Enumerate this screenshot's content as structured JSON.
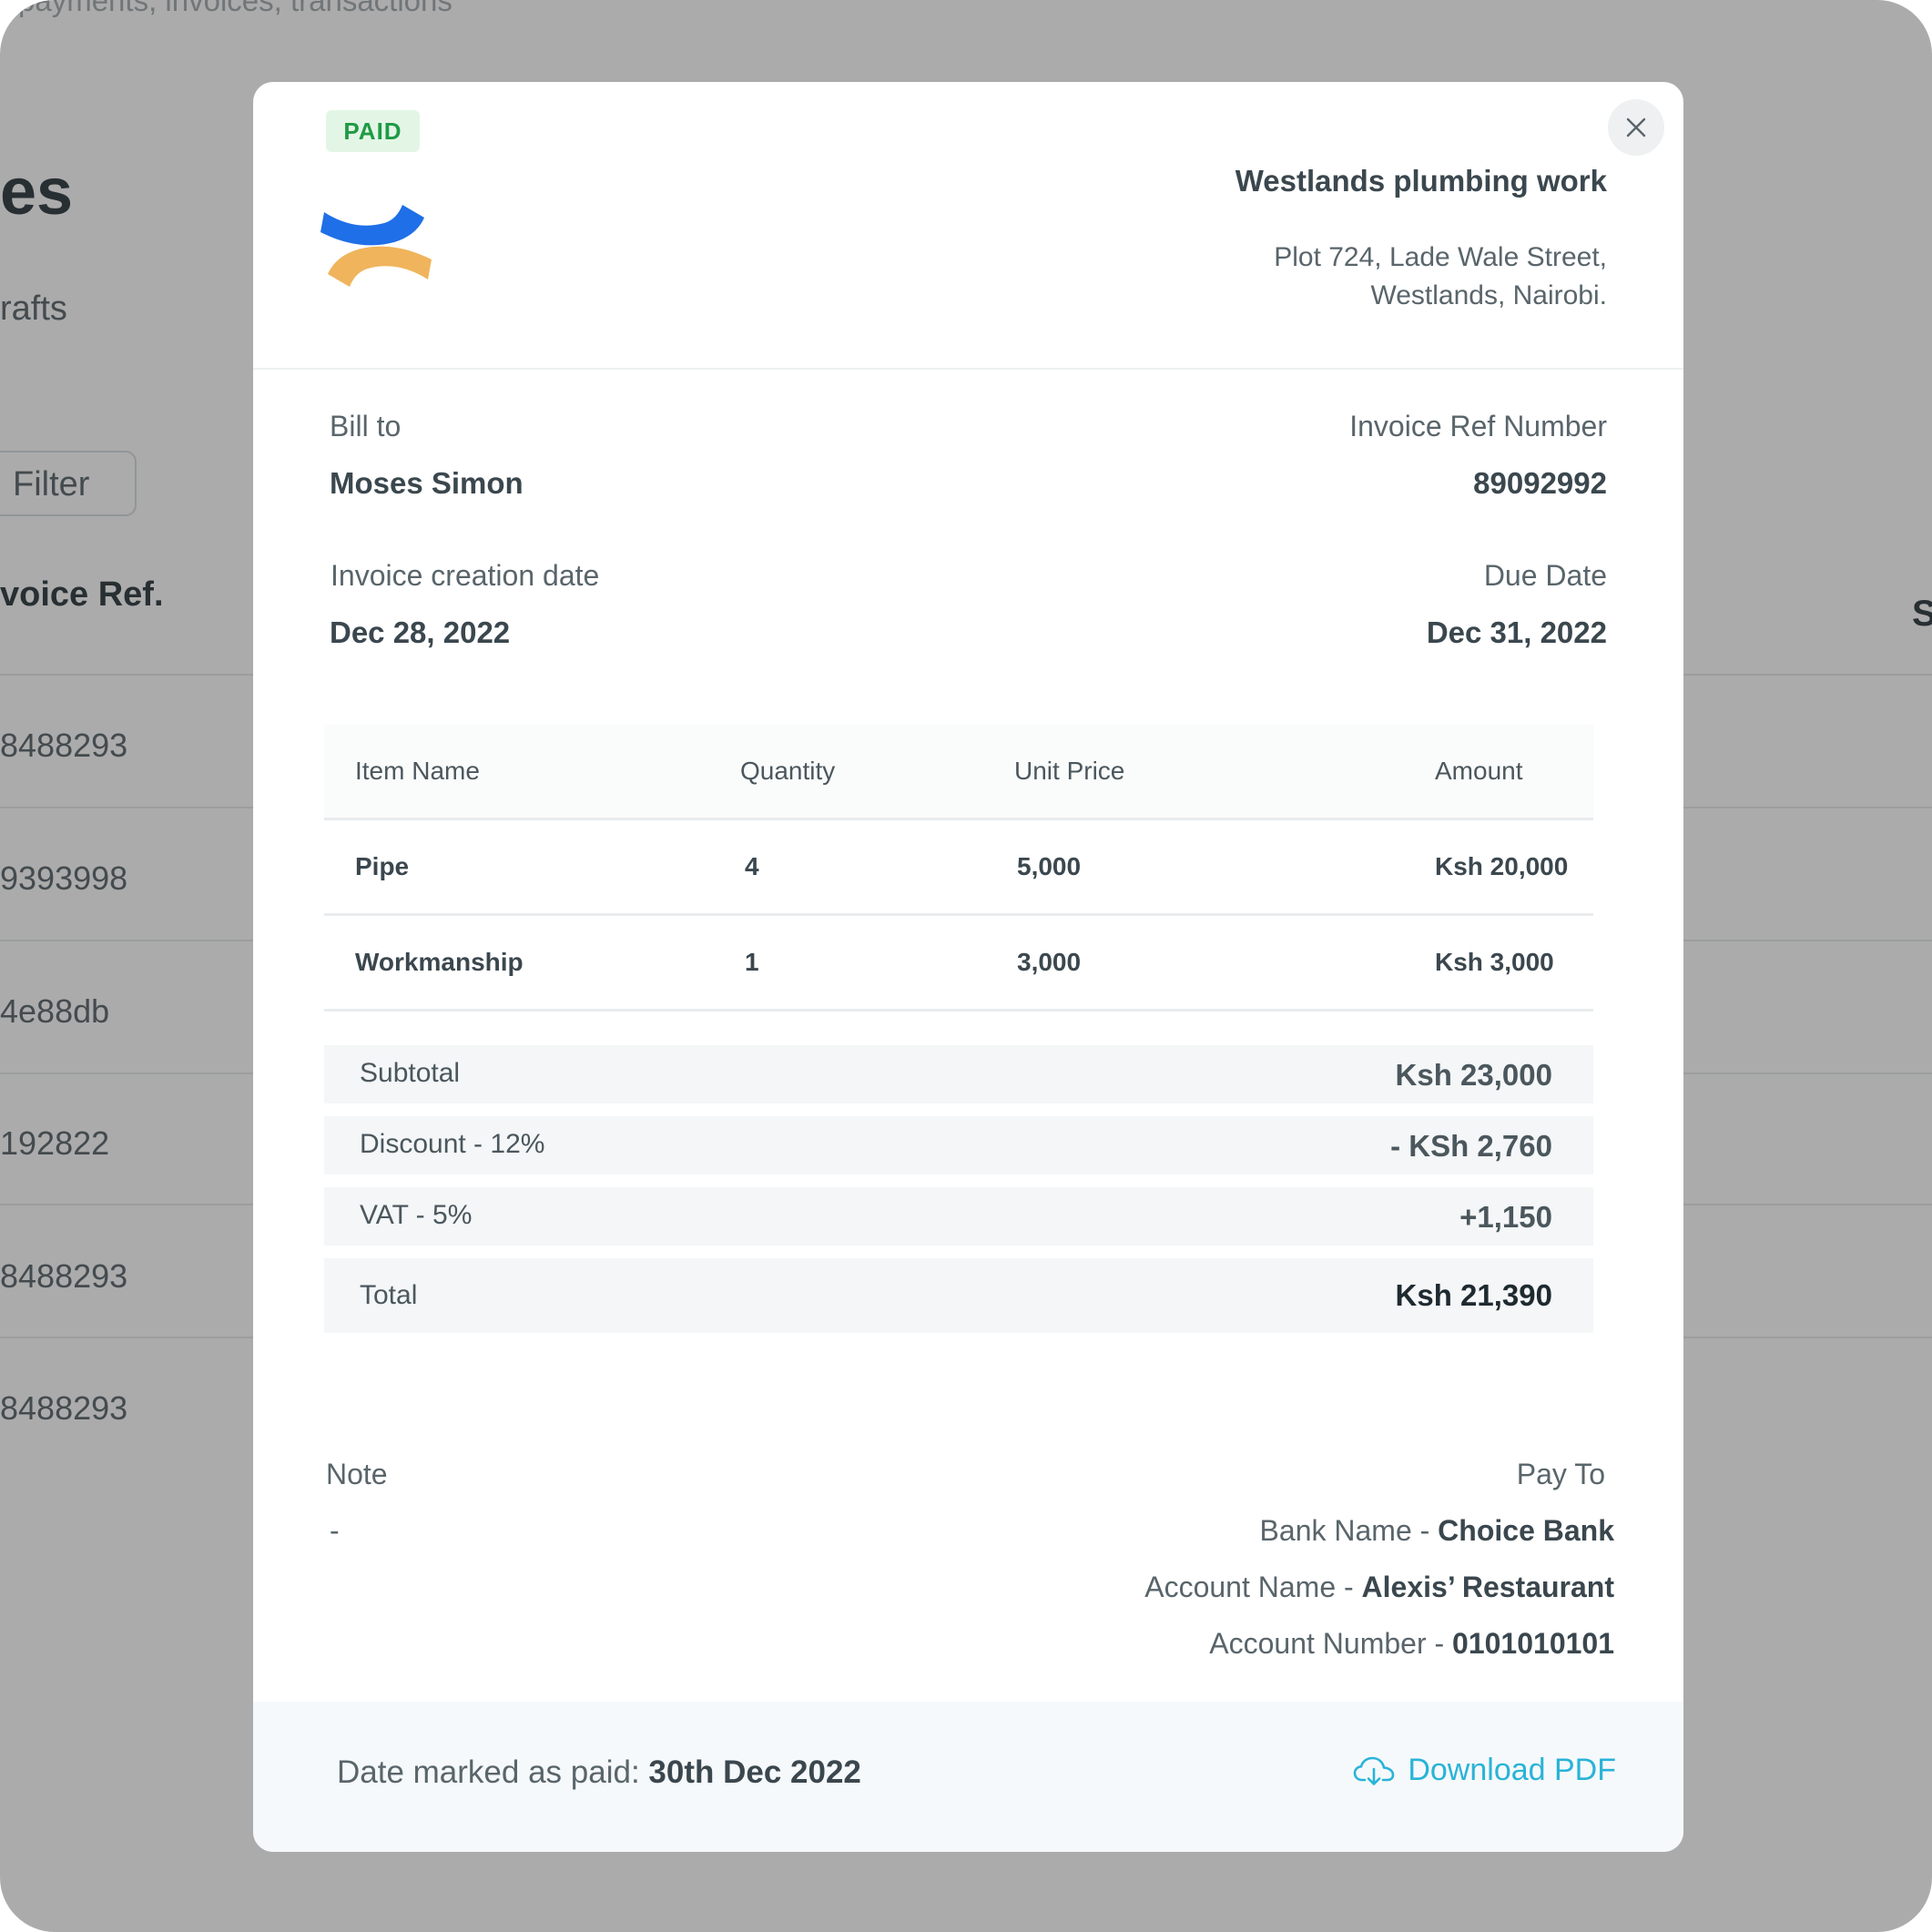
{
  "background": {
    "subtitle": "payments, invoices, transactions",
    "title_fragment": "es",
    "tab_fragment": "rafts",
    "filter_label": "Filter",
    "column_header_fragment": "voice Ref.",
    "column_header_right_fragment": "S",
    "rows": [
      "8488293",
      "9393998",
      "4e88db",
      "192822",
      "8488293",
      "8488293"
    ]
  },
  "invoice": {
    "status_badge": "PAID",
    "company": {
      "name": "Westlands plumbing work",
      "address_line1": "Plot 724, Lade Wale Street,",
      "address_line2": "Westlands, Nairobi."
    },
    "bill_to_label": "Bill to",
    "bill_to_name": "Moses Simon",
    "ref_label": "Invoice Ref Number",
    "ref_value": "89092992",
    "creation_label": "Invoice creation date",
    "creation_date": "Dec 28, 2022",
    "due_label": "Due Date",
    "due_date": "Dec 31, 2022",
    "table": {
      "headers": {
        "item": "Item Name",
        "quantity": "Quantity",
        "unit_price": "Unit Price",
        "amount": "Amount"
      },
      "rows": [
        {
          "item": "Pipe",
          "quantity": "4",
          "unit_price": "5,000",
          "amount": "Ksh 20,000"
        },
        {
          "item": "Workmanship",
          "quantity": "1",
          "unit_price": "3,000",
          "amount": "Ksh 3,000"
        }
      ]
    },
    "summary": {
      "subtotal_label": "Subtotal",
      "subtotal_value": "Ksh 23,000",
      "discount_label": "Discount - 12%",
      "discount_value": "- KSh 2,760",
      "vat_label": "VAT - 5%",
      "vat_value": "+1,150",
      "total_label": "Total",
      "total_value": "Ksh 21,390"
    },
    "note_label": "Note",
    "note_value": "-",
    "pay_to": {
      "label": "Pay To",
      "bank_label": "Bank Name - ",
      "bank_value": "Choice Bank",
      "account_name_label": "Account Name - ",
      "account_name_value": "Alexis’ Restaurant",
      "account_number_label": "Account Number - ",
      "account_number_value": "0101010101"
    },
    "footer": {
      "paid_date_label": "Date marked as paid: ",
      "paid_date_value": "30th Dec 2022",
      "download_label": "Download PDF"
    }
  },
  "colors": {
    "accent": "#2ab3d8",
    "paid_badge_bg": "#e3f6e6",
    "paid_badge_text": "#1f9a45",
    "logo_blue": "#1f6fe8",
    "logo_orange": "#f0b45c"
  },
  "icons": {
    "close": "close-icon",
    "download": "cloud-download-icon",
    "logo": "company-logo"
  }
}
